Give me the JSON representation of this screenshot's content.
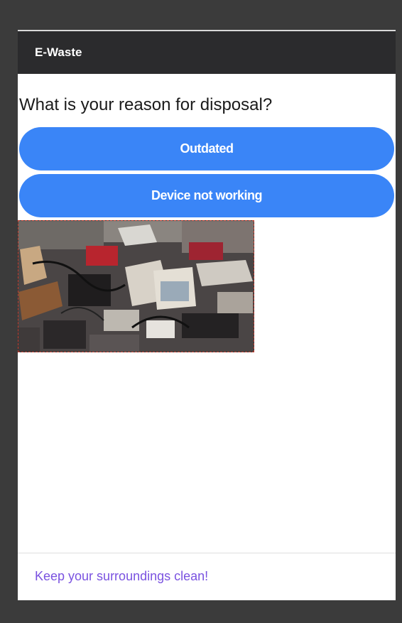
{
  "app": {
    "title": "E-Waste"
  },
  "main": {
    "question": "What is your reason for disposal?",
    "options": [
      {
        "label": "Outdated"
      },
      {
        "label": "Device not working"
      }
    ],
    "image": {
      "icon": "e-waste-pile-photo"
    }
  },
  "footer": {
    "text": "Keep your surroundings clean!"
  },
  "colors": {
    "topbar": "#2b2b2d",
    "button": "#3a85f7",
    "footer_text": "#7a52e0",
    "frame": "#3b3b3b"
  }
}
